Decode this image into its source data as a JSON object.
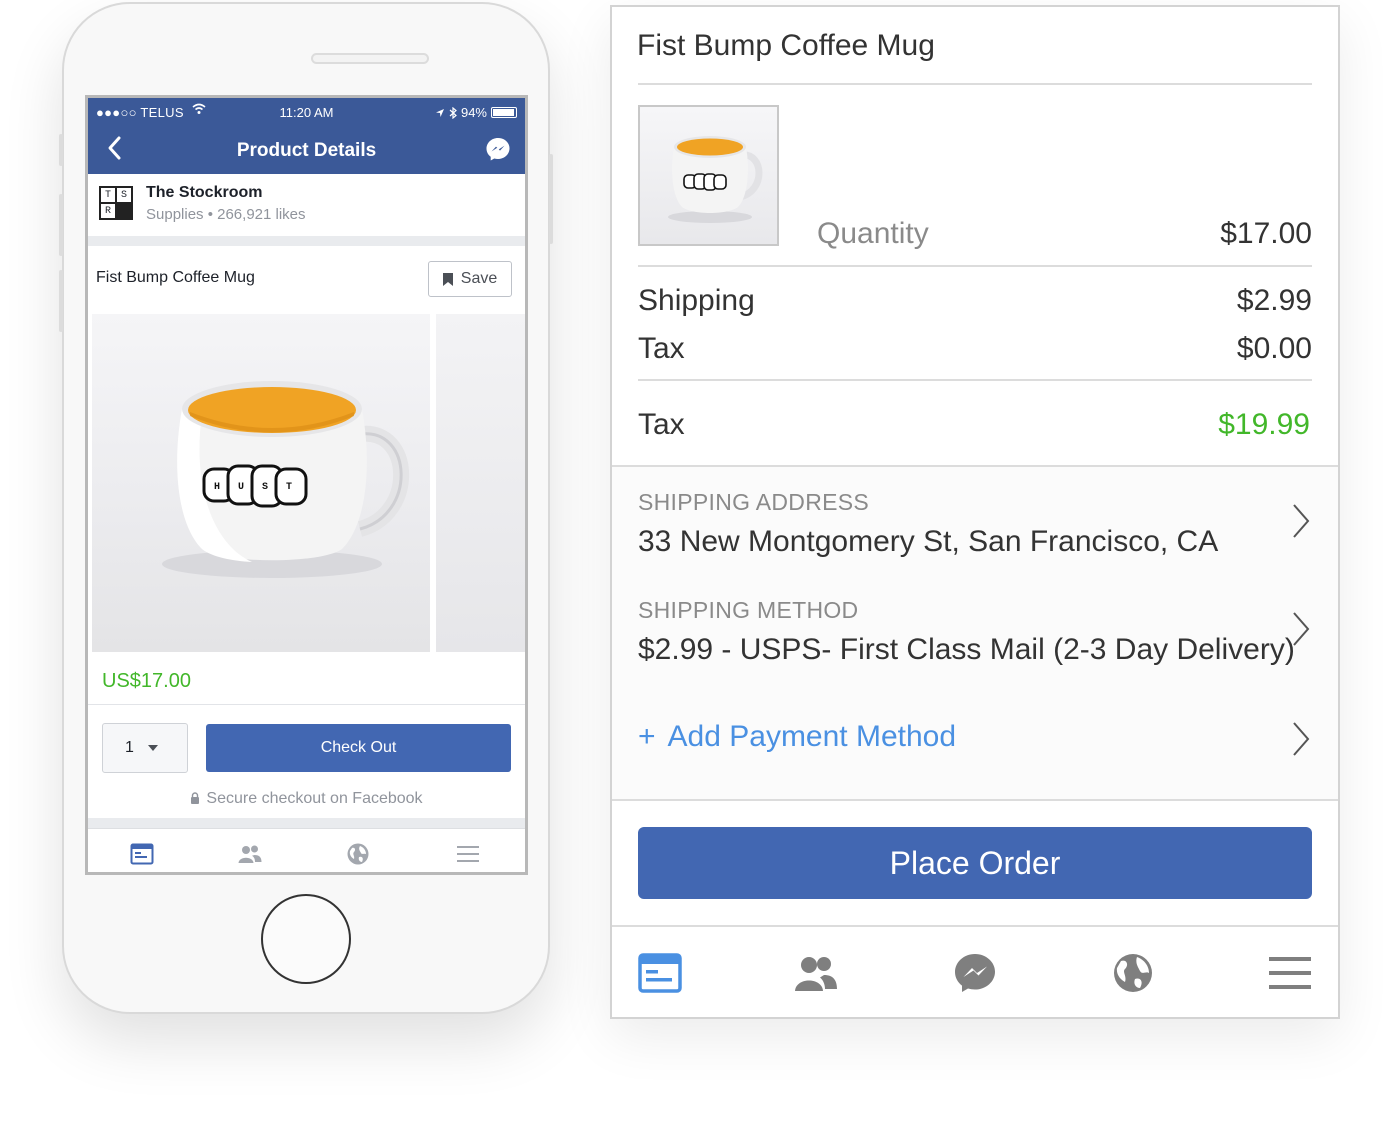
{
  "phone": {
    "status": {
      "carrier": "●●●○○ TELUS",
      "time": "11:20 AM",
      "battery": "94%",
      "battery_level": 0.94
    },
    "nav": {
      "title": "Product Details"
    },
    "page": {
      "logo_letters": [
        "T",
        "S",
        "R",
        ""
      ],
      "name": "The Stockroom",
      "meta": "Supplies • 266,921 likes"
    },
    "product": {
      "title": "Fist Bump Coffee Mug",
      "save_label": "Save",
      "price": "US$17.00",
      "quantity": "1",
      "checkout_label": "Check Out",
      "secure_text": "Secure checkout on Facebook"
    },
    "tabs": [
      "news-feed-icon",
      "friends-icon",
      "globe-icon",
      "menu-icon"
    ]
  },
  "panel": {
    "title": "Fist Bump Coffee Mug",
    "quantity_label": "Quantity",
    "item_price": "$17.00",
    "shipping_label": "Shipping",
    "shipping_value": "$2.99",
    "tax_label": "Tax",
    "tax_value": "$0.00",
    "total_label": "Tax",
    "total_value": "$19.99",
    "shipping_address_caption": "SHIPPING ADDRESS",
    "shipping_address": "33 New Montgomery St, San Francisco, CA",
    "shipping_method_caption": "SHIPPING METHOD",
    "shipping_method": "$2.99 - USPS- First Class Mail (2-3 Day Delivery)",
    "add_payment_plus": "+",
    "add_payment_label": "Add Payment Method",
    "place_order_label": "Place Order",
    "tabs": [
      "news-feed-icon",
      "friends-icon",
      "messenger-icon",
      "globe-icon",
      "menu-icon"
    ]
  },
  "colors": {
    "facebook_blue": "#3b5998",
    "button_blue": "#4267b2",
    "link_blue": "#4a90e2",
    "price_green": "#42b72a",
    "mug_inner": "#f0a324"
  }
}
